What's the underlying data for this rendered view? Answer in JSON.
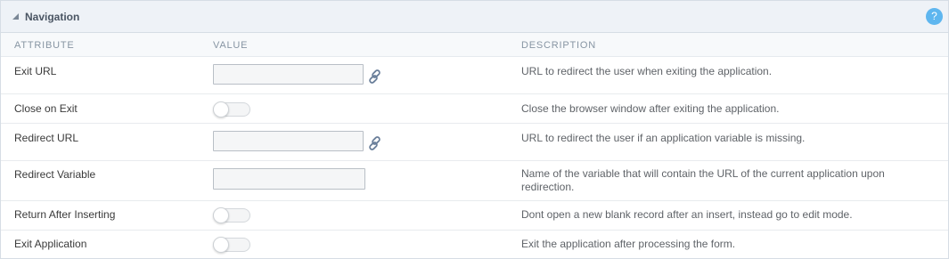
{
  "section": {
    "title": "Navigation",
    "help_label": "?"
  },
  "columns": {
    "attribute": "ATTRIBUTE",
    "value": "VALUE",
    "description": "DESCRIPTION"
  },
  "rows": [
    {
      "attribute": "Exit URL",
      "control": "text-link",
      "value": "",
      "description": "URL to redirect the user when exiting the application."
    },
    {
      "attribute": "Close on Exit",
      "control": "toggle",
      "value": false,
      "description": "Close the browser window after exiting the application."
    },
    {
      "attribute": "Redirect URL",
      "control": "text-link",
      "value": "",
      "description": "URL to redirect the user if an application variable is missing."
    },
    {
      "attribute": "Redirect Variable",
      "control": "text",
      "value": "",
      "description": "Name of the variable that will contain the URL of the current application upon redirection."
    },
    {
      "attribute": "Return After Inserting",
      "control": "toggle",
      "value": false,
      "description": "Dont open a new blank record after an insert, instead go to edit mode."
    },
    {
      "attribute": "Exit Application",
      "control": "toggle",
      "value": false,
      "description": "Exit the application after processing the form."
    }
  ],
  "icons": {
    "collapse": "collapse-triangle-icon",
    "link": "link-chain-icon",
    "help": "help-icon"
  },
  "colors": {
    "accent": "#5eb6ef",
    "header_bg": "#eef2f7",
    "link_icon": "#6a7f9a"
  }
}
